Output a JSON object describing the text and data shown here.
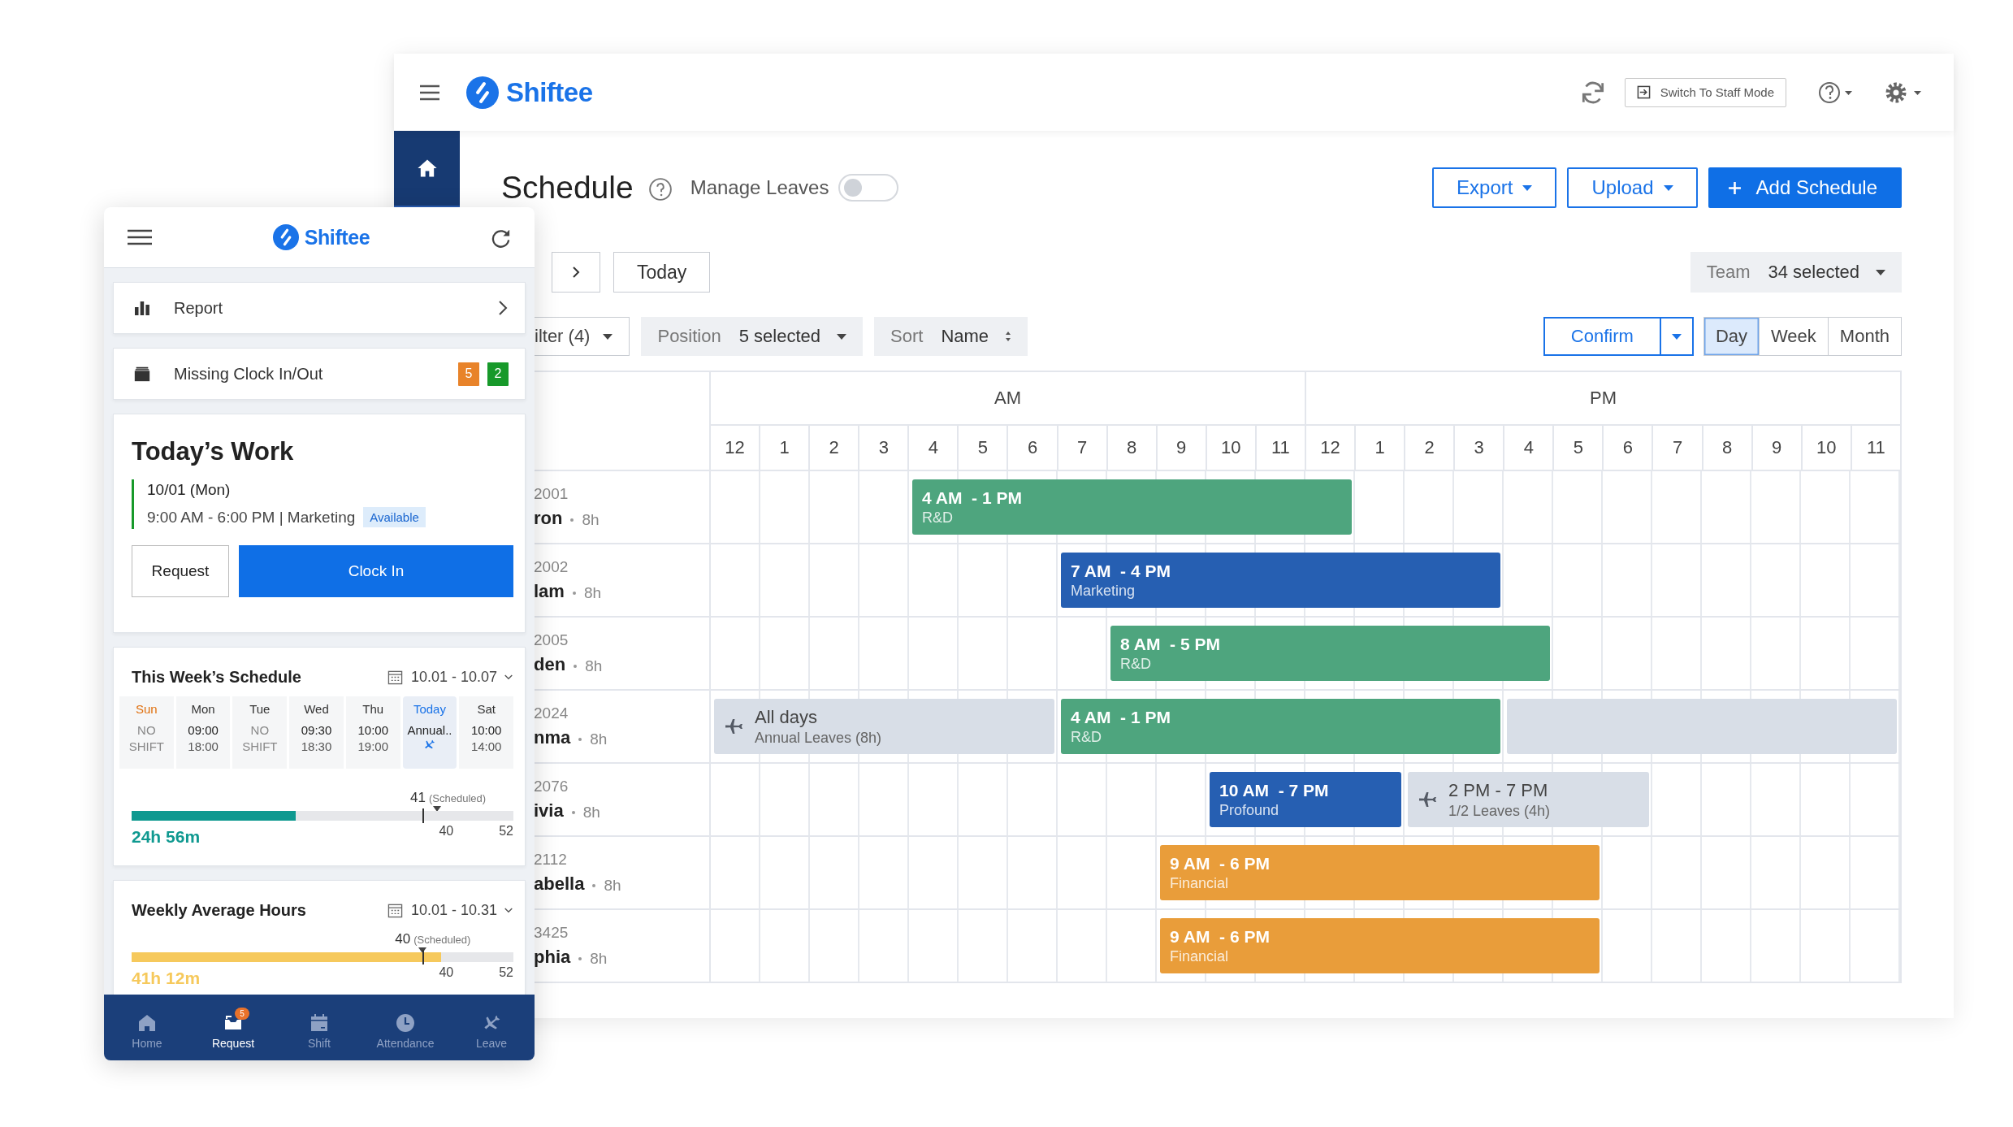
{
  "desktop": {
    "logo": "Shiftee",
    "staff_mode_button": "Switch To Staff Mode",
    "title": "Schedule",
    "manage_leaves": {
      "label": "Manage Leaves",
      "on": false
    },
    "export_button": "Export",
    "upload_button": "Upload",
    "add_button": "Add Schedule",
    "today_button": "Today",
    "team": {
      "label": "Team",
      "value": "34 selected"
    },
    "filter_button": "ilter (4)",
    "position": {
      "label": "Position",
      "value": "5 selected"
    },
    "sort": {
      "label": "Sort",
      "value": "Name"
    },
    "confirm_button": "Confirm",
    "views": [
      {
        "label": "Day",
        "selected": true
      },
      {
        "label": "Week",
        "selected": false
      },
      {
        "label": "Month",
        "selected": false
      }
    ],
    "grid": {
      "periods": [
        "AM",
        "PM"
      ],
      "hours": [
        "12",
        "1",
        "2",
        "3",
        "4",
        "5",
        "6",
        "7",
        "8",
        "9",
        "10",
        "11",
        "12",
        "1",
        "2",
        "3",
        "4",
        "5",
        "6",
        "7",
        "8",
        "9",
        "10",
        "11"
      ],
      "rows": [
        {
          "id": "2001",
          "name": "ron",
          "hours": "8h",
          "bars": [
            {
              "kind": "shift",
              "time": "4 AM  - 1 PM",
              "team": "R&D",
              "color": "#4ea57e"
            }
          ]
        },
        {
          "id": "2002",
          "name": "lam",
          "hours": "8h",
          "bars": [
            {
              "kind": "shift",
              "time": "7 AM  - 4 PM",
              "team": "Marketing",
              "color": "#265fb2"
            }
          ]
        },
        {
          "id": "2005",
          "name": "den",
          "hours": "8h",
          "bars": [
            {
              "kind": "shift",
              "time": "8 AM  - 5 PM",
              "team": "R&D",
              "color": "#4ea57e"
            }
          ]
        },
        {
          "id": "2024",
          "name": "nma",
          "hours": "8h",
          "bars": [
            {
              "kind": "leave",
              "title": "All days",
              "note": "Annual Leaves (8h)"
            },
            {
              "kind": "shift",
              "time": "4 AM  - 1 PM",
              "team": "R&D",
              "color": "#4ea57e"
            },
            {
              "kind": "leave"
            }
          ]
        },
        {
          "id": "2076",
          "name": "ivia",
          "hours": "8h",
          "bars": [
            {
              "kind": "shift",
              "time": "10 AM  - 7 PM",
              "team": "Profound",
              "color": "#265fb2"
            },
            {
              "kind": "leave",
              "title": "2 PM - 7 PM",
              "note": "1/2 Leaves (4h)"
            }
          ]
        },
        {
          "id": "2112",
          "name": "abella",
          "hours": "8h",
          "bars": [
            {
              "kind": "shift",
              "time": "9 AM  - 6 PM",
              "team": "Financial",
              "color": "#e99d3a"
            }
          ]
        },
        {
          "id": "3425",
          "name": "phia",
          "hours": "8h",
          "bars": [
            {
              "kind": "shift",
              "time": "9 AM  - 6 PM",
              "team": "Financial",
              "color": "#e99d3a"
            }
          ]
        }
      ]
    }
  },
  "mobile": {
    "logo": "Shiftee",
    "menu": [
      {
        "label": "Report",
        "kind": "link"
      },
      {
        "label": "Missing Clock In/Out",
        "kind": "badges",
        "badges": [
          {
            "text": "5",
            "color": "#e8832a"
          },
          {
            "text": "2",
            "color": "#17992a"
          }
        ]
      }
    ],
    "today": {
      "title": "Today’s Work",
      "date": "10/01 (Mon)",
      "time": "9:00 AM - 6:00 PM | Marketing",
      "status": "Available",
      "request_button": "Request",
      "clock_in_button": "Clock In"
    },
    "week": {
      "title": "This Week’s Schedule",
      "range": "10.01 - 10.07",
      "days": [
        {
          "day": "Sun",
          "color": "#e0700f",
          "selected": false,
          "kind": "off",
          "lines": [
            "NO",
            "SHIFT"
          ]
        },
        {
          "day": "Mon",
          "color": "#333333",
          "selected": false,
          "kind": "shift",
          "lines": [
            "09:00",
            "18:00"
          ]
        },
        {
          "day": "Tue",
          "color": "#333333",
          "selected": false,
          "kind": "off",
          "lines": [
            "NO",
            "SHIFT"
          ]
        },
        {
          "day": "Wed",
          "color": "#333333",
          "selected": false,
          "kind": "shift",
          "lines": [
            "09:30",
            "18:30"
          ]
        },
        {
          "day": "Thu",
          "color": "#333333",
          "selected": false,
          "kind": "shift",
          "lines": [
            "10:00",
            "19:00"
          ]
        },
        {
          "day": "Today",
          "color": "#1a73e8",
          "selected": true,
          "kind": "leave",
          "lines": [
            "Annual.."
          ]
        },
        {
          "day": "Sat",
          "color": "#333333",
          "selected": false,
          "kind": "shift",
          "lines": [
            "10:00",
            "14:00"
          ]
        }
      ],
      "target": "41",
      "target_note": "(Scheduled)",
      "level": 0.43,
      "total": "24h 56m",
      "ticks": [
        "40",
        "52"
      ]
    },
    "average": {
      "title": "Weekly Average Hours",
      "range": "10.01 - 10.31",
      "target": "40",
      "target_note": "(Scheduled)",
      "level": 0.81,
      "total": "41h 12m",
      "ticks": [
        "40",
        "52"
      ]
    },
    "tabs": [
      {
        "label": "Home",
        "selected": false
      },
      {
        "label": "Request",
        "selected": true,
        "badge": "5"
      },
      {
        "label": "Shift",
        "selected": false
      },
      {
        "label": "Attendance",
        "selected": false
      },
      {
        "label": "Leave",
        "selected": false
      }
    ]
  }
}
